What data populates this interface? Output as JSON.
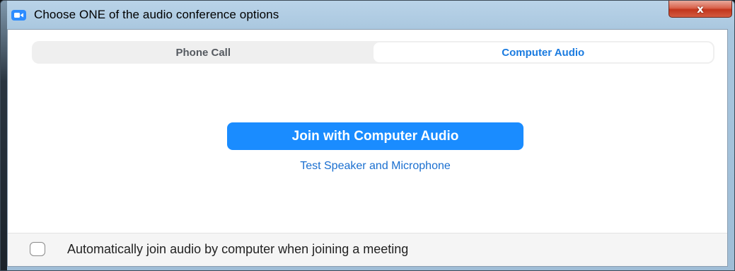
{
  "window": {
    "title": "Choose ONE of the audio conference options",
    "close_glyph": "x"
  },
  "icons": {
    "app": "zoom-camera-icon"
  },
  "tabs": [
    {
      "label": "Phone Call",
      "active": false
    },
    {
      "label": "Computer Audio",
      "active": true
    }
  ],
  "main": {
    "join_label": "Join with Computer Audio",
    "test_link": "Test Speaker and Microphone"
  },
  "footer": {
    "auto_join_label": "Automatically join audio by computer when joining a meeting",
    "auto_join_checked": false
  },
  "colors": {
    "accent": "#1a8cff",
    "link": "#1a6fd0",
    "close": "#c2361d"
  }
}
